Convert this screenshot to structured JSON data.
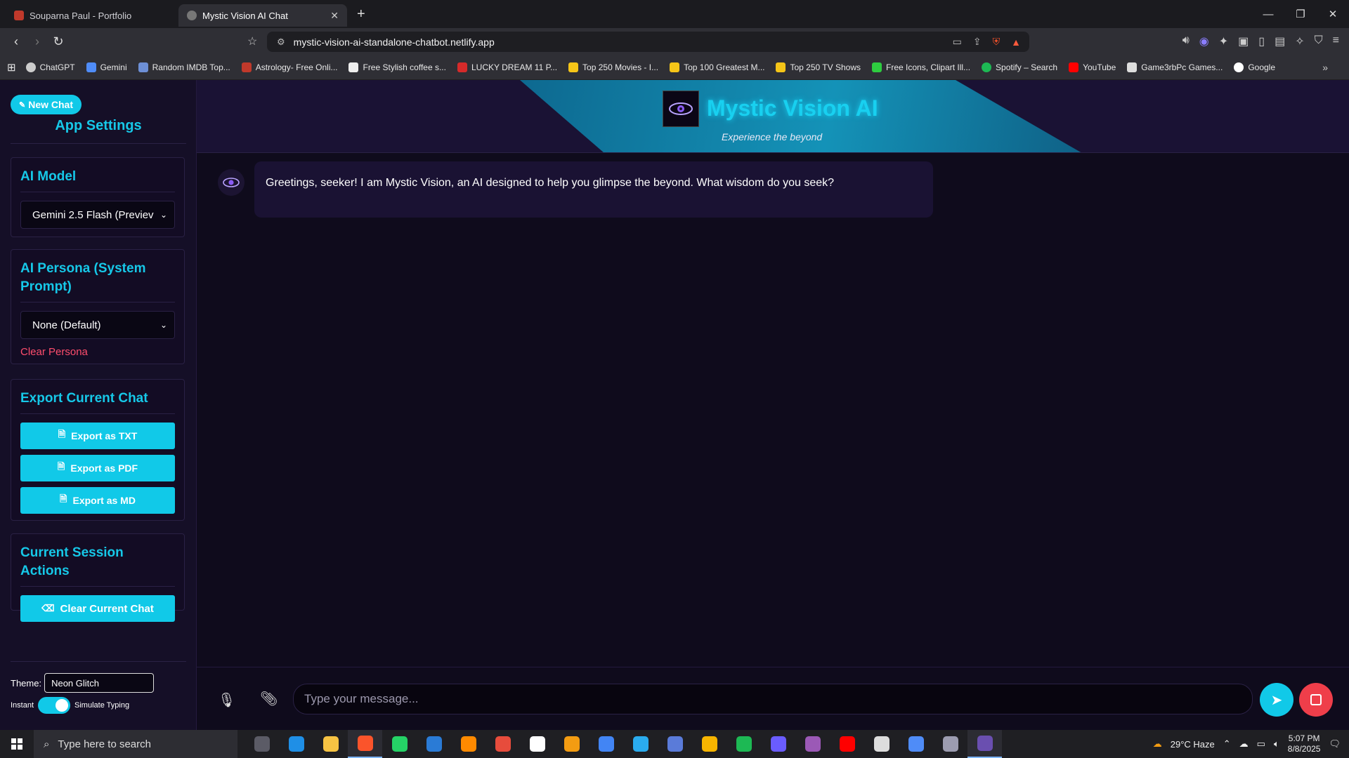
{
  "browser": {
    "tabs": [
      {
        "title": "Souparna Paul - Portfolio",
        "active": false
      },
      {
        "title": "Mystic Vision AI Chat",
        "active": true
      }
    ],
    "url": "mystic-vision-ai-standalone-chatbot.netlify.app",
    "bookmarks": [
      {
        "label": "ChatGPT",
        "color": "#cccccc"
      },
      {
        "label": "Gemini",
        "color": "#4f8cf7"
      },
      {
        "label": "Random IMDB Top...",
        "color": "#6d8fd6"
      },
      {
        "label": "Astrology- Free Onli...",
        "color": "#c0392b"
      },
      {
        "label": "Free Stylish coffee s...",
        "color": "#eeeeee"
      },
      {
        "label": "LUCKY DREAM 11 P...",
        "color": "#d62a2a"
      },
      {
        "label": "Top 250 Movies - I...",
        "color": "#f5c518"
      },
      {
        "label": "Top 100 Greatest M...",
        "color": "#f5c518"
      },
      {
        "label": "Top 250 TV Shows",
        "color": "#f5c518"
      },
      {
        "label": "Free Icons, Clipart Ill...",
        "color": "#2ecc40"
      },
      {
        "label": "Spotify – Search",
        "color": "#1db954"
      },
      {
        "label": "YouTube",
        "color": "#ff0000"
      },
      {
        "label": "Game3rbPc Games...",
        "color": "#dddddd"
      },
      {
        "label": "Google",
        "color": "#ffffff"
      }
    ]
  },
  "sidebar": {
    "new_chat": "New Chat",
    "title": "App Settings",
    "ai_model": {
      "heading": "AI Model",
      "selected": "Gemini 2.5 Flash (Previev"
    },
    "persona": {
      "heading": "AI Persona (System Prompt)",
      "selected": "None (Default)",
      "clear": "Clear Persona"
    },
    "export": {
      "heading": "Export Current Chat",
      "txt": "Export as TXT",
      "pdf": "Export as PDF",
      "md": "Export as MD"
    },
    "session": {
      "heading": "Current Session Actions",
      "clear": "Clear Current Chat"
    },
    "theme_label": "Theme:",
    "theme_value": "Neon Glitch",
    "toggle_left": "Instant",
    "toggle_right": "Simulate Typing"
  },
  "header": {
    "brand": "Mystic Vision AI",
    "tagline": "Experience the beyond"
  },
  "chat": {
    "messages": [
      {
        "role": "assistant",
        "text": "Greetings, seeker! I am Mystic Vision, an AI designed to help you glimpse the beyond. What wisdom do you seek?"
      }
    ],
    "input_placeholder": "Type your message..."
  },
  "taskbar": {
    "search_placeholder": "Type here to search",
    "weather": "29°C  Haze",
    "time": "5:07 PM",
    "date": "8/8/2025",
    "apps": [
      "#5b5b66",
      "#1f8fe6",
      "#f6c343",
      "#fb542b",
      "#25d366",
      "#2a7bd6",
      "#ff8a00",
      "#e74c3c",
      "#ffffff",
      "#f39c12",
      "#4285f4",
      "#2aabee",
      "#5a7bd9",
      "#f7b500",
      "#1db954",
      "#6a5cff",
      "#9b59b6",
      "#ff0000",
      "#dddddd",
      "#4f8cf7",
      "#9c9cb0",
      "#6a4fb0"
    ]
  }
}
